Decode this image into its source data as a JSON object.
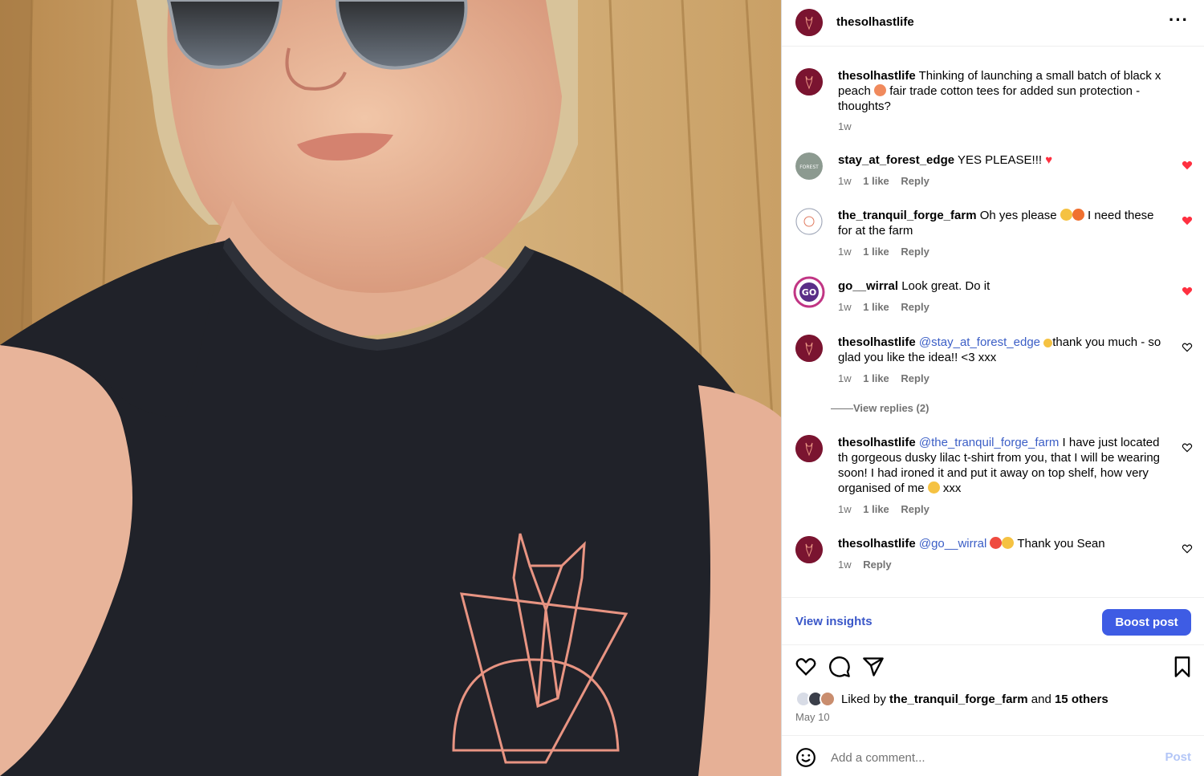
{
  "header": {
    "username": "thesolhastlife",
    "more_icon": "more-horizontal-icon"
  },
  "caption": {
    "username": "thesolhastlife",
    "text_before_emoji": "Thinking of launching a small batch of black x peach",
    "emoji": "peach",
    "text_after_emoji": "fair trade cotton tees for added sun protection - thoughts?",
    "time": "1w"
  },
  "comments": [
    {
      "username": "stay_at_forest_edge",
      "text": "YES PLEASE!!!",
      "emoji": "red-heart",
      "time": "1w",
      "likes": "1 like",
      "reply": "Reply",
      "liked": true
    },
    {
      "username": "the_tranquil_forge_farm",
      "text_a": "Oh yes please",
      "emoji": "raised-hands fire",
      "text_b": "I need these for at the farm",
      "time": "1w",
      "likes": "1 like",
      "reply": "Reply",
      "liked": true
    },
    {
      "username": "go__wirral",
      "text": "Look great. Do it",
      "time": "1w",
      "likes": "1 like",
      "reply": "Reply",
      "liked": true
    },
    {
      "username": "thesolhastlife",
      "mention": "@stay_at_forest_edge",
      "emoji": "hands",
      "text": "thank you much - so glad you like the idea!! <3 xxx",
      "time": "1w",
      "likes": "1 like",
      "reply": "Reply",
      "liked": false,
      "view_replies": "View replies (2)"
    },
    {
      "username": "thesolhastlife",
      "mention": "@the_tranquil_forge_farm",
      "text": "I have just located th gorgeous dusky lilac t-shirt from you, that I will be wearing soon! I had ironed it and put it away on top shelf, how very organised of me",
      "emoji": "laughing",
      "text_end": "xxx",
      "time": "1w",
      "likes": "1 like",
      "reply": "Reply",
      "liked": false
    },
    {
      "username": "thesolhastlife",
      "mention": "@go__wirral",
      "emoji": "hundred clapping",
      "text": "Thank you Sean",
      "time": "1w",
      "reply": "Reply",
      "liked": false
    }
  ],
  "insights": {
    "view_insights": "View insights",
    "boost_post": "Boost post"
  },
  "likes": {
    "prefix": "Liked by",
    "user": "the_tranquil_forge_farm",
    "and": "and",
    "others": "15 others",
    "date": "May 10"
  },
  "comment_box": {
    "placeholder": "Add a comment...",
    "post": "Post"
  },
  "colors": {
    "accent": "#3e5ce4",
    "link": "#3a57c9",
    "liked_heart": "#ff3040",
    "avatar": "#7a1430"
  }
}
